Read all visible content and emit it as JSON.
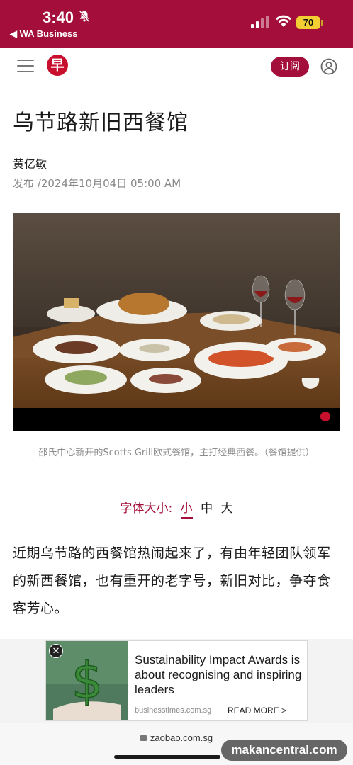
{
  "status_bar": {
    "time": "3:40",
    "back_app": "◀ WA Business",
    "battery": "70"
  },
  "header": {
    "logo_char": "早",
    "subscribe_label": "订阅",
    "colors": {
      "brand": "#a30f3a",
      "logo": "#c8102e"
    }
  },
  "article": {
    "title": "乌节路新旧西餐馆",
    "author": "黄亿敏",
    "published": "发布 /2024年10月04日 05:00 AM",
    "image_caption": "邵氏中心新开的Scotts Grill欧式餐馆，主打经典西餐。（餐馆提供）",
    "font_size": {
      "label": "字体大小:",
      "options": [
        "小",
        "中",
        "大"
      ],
      "selected": "小"
    },
    "body": "近期乌节路的西餐馆热闹起来了，有由年轻团队领军的新西餐馆，也有重开的老字号，新旧对比，争夺食客芳心。"
  },
  "ad": {
    "close": "✕",
    "headline": "Sustainability Impact Awards is about recognising and inspiring leaders",
    "domain": "businesstimes.com.sg",
    "cta": "READ MORE >"
  },
  "browser": {
    "url": "zaobao.com.sg"
  },
  "watermark": "makancentral.com"
}
